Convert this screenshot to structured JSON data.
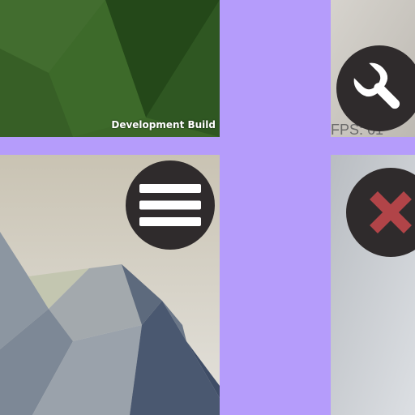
{
  "panels": {
    "top_left": {
      "footer_label": "Development Build",
      "colors": {
        "base": "#3e6a2c",
        "shade": "#2a4d1f"
      }
    },
    "top_right": {
      "colors": {
        "base": "#c9c6c0"
      }
    },
    "bottom_left": {
      "colors": {
        "sky": "#d7d3c9",
        "rock": "#7f8a97"
      }
    },
    "bottom_right": {
      "colors": {
        "base": "#c7cbd0"
      }
    }
  },
  "overlay": {
    "fps_text": "FPS: 61"
  },
  "buttons": {
    "settings": {
      "icon": "wrench-icon",
      "color": "#ffffff"
    },
    "menu": {
      "icon": "hamburger-menu-icon",
      "color": "#ffffff"
    },
    "close": {
      "icon": "close-x-icon",
      "color": "#b14448"
    }
  },
  "colors": {
    "background": "#b59cfb",
    "button_bg": "#2f2b2c"
  }
}
